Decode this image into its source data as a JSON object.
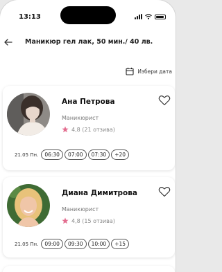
{
  "status": {
    "time": "13:13"
  },
  "header": {
    "title": "Маникюр гел лак, 50 мин./ 40 лв."
  },
  "date_picker": {
    "label": "Избери дата"
  },
  "colors": {
    "accent": "#e36d8f",
    "text": "#222222",
    "muted": "#777777"
  },
  "specialists": [
    {
      "name": "Ана Петрова",
      "role": "Маникюрист",
      "rating": "4,8 (21 отзива)",
      "day": "21.05 Пн.",
      "slots": [
        "06:30",
        "07:00",
        "07:30",
        "+20"
      ]
    },
    {
      "name": "Диана Димитрова",
      "role": "Маникюрист",
      "rating": "4,8 (15 отзива)",
      "day": "21.05 Пн.",
      "slots": [
        "09:00",
        "09:30",
        "10:00",
        "+15"
      ]
    }
  ]
}
